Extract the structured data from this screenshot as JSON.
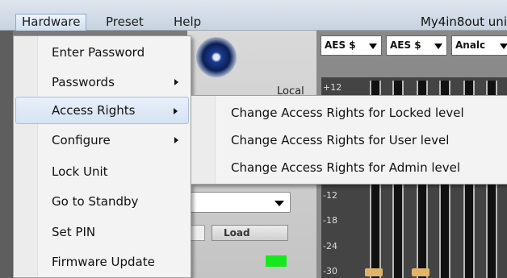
{
  "menubar": {
    "items": [
      {
        "label": "Hardware"
      },
      {
        "label": "Preset"
      },
      {
        "label": "Help"
      }
    ],
    "unit_title": "My4in8out uni"
  },
  "background": {
    "local_label": "Local",
    "load_label": "Load",
    "input_selects": [
      "AES $",
      "AES $",
      "Analc"
    ],
    "meter_scale": [
      "+12",
      "-12",
      "-18",
      "-24",
      "-30"
    ],
    "led_color": "#15e81b"
  },
  "hardware_menu": {
    "items": [
      {
        "label": "Enter Password",
        "has_submenu": false
      },
      {
        "label": "Passwords",
        "has_submenu": true
      },
      {
        "label": "Access Rights",
        "has_submenu": true,
        "highlighted": true
      },
      {
        "label": "Configure",
        "has_submenu": true
      },
      {
        "label": "Lock Unit",
        "has_submenu": false
      },
      {
        "label": "Go to Standby",
        "has_submenu": false
      },
      {
        "label": "Set PIN",
        "has_submenu": false
      },
      {
        "label": "Firmware Update",
        "has_submenu": false
      }
    ]
  },
  "access_rights_submenu": {
    "items": [
      {
        "label": "Change Access Rights for Locked level"
      },
      {
        "label": "Change Access Rights for User level"
      },
      {
        "label": "Change Access Rights for Admin level"
      }
    ]
  },
  "colors": {
    "highlight": "#d6e3f3",
    "menu_bg": "#f3f3f3"
  }
}
